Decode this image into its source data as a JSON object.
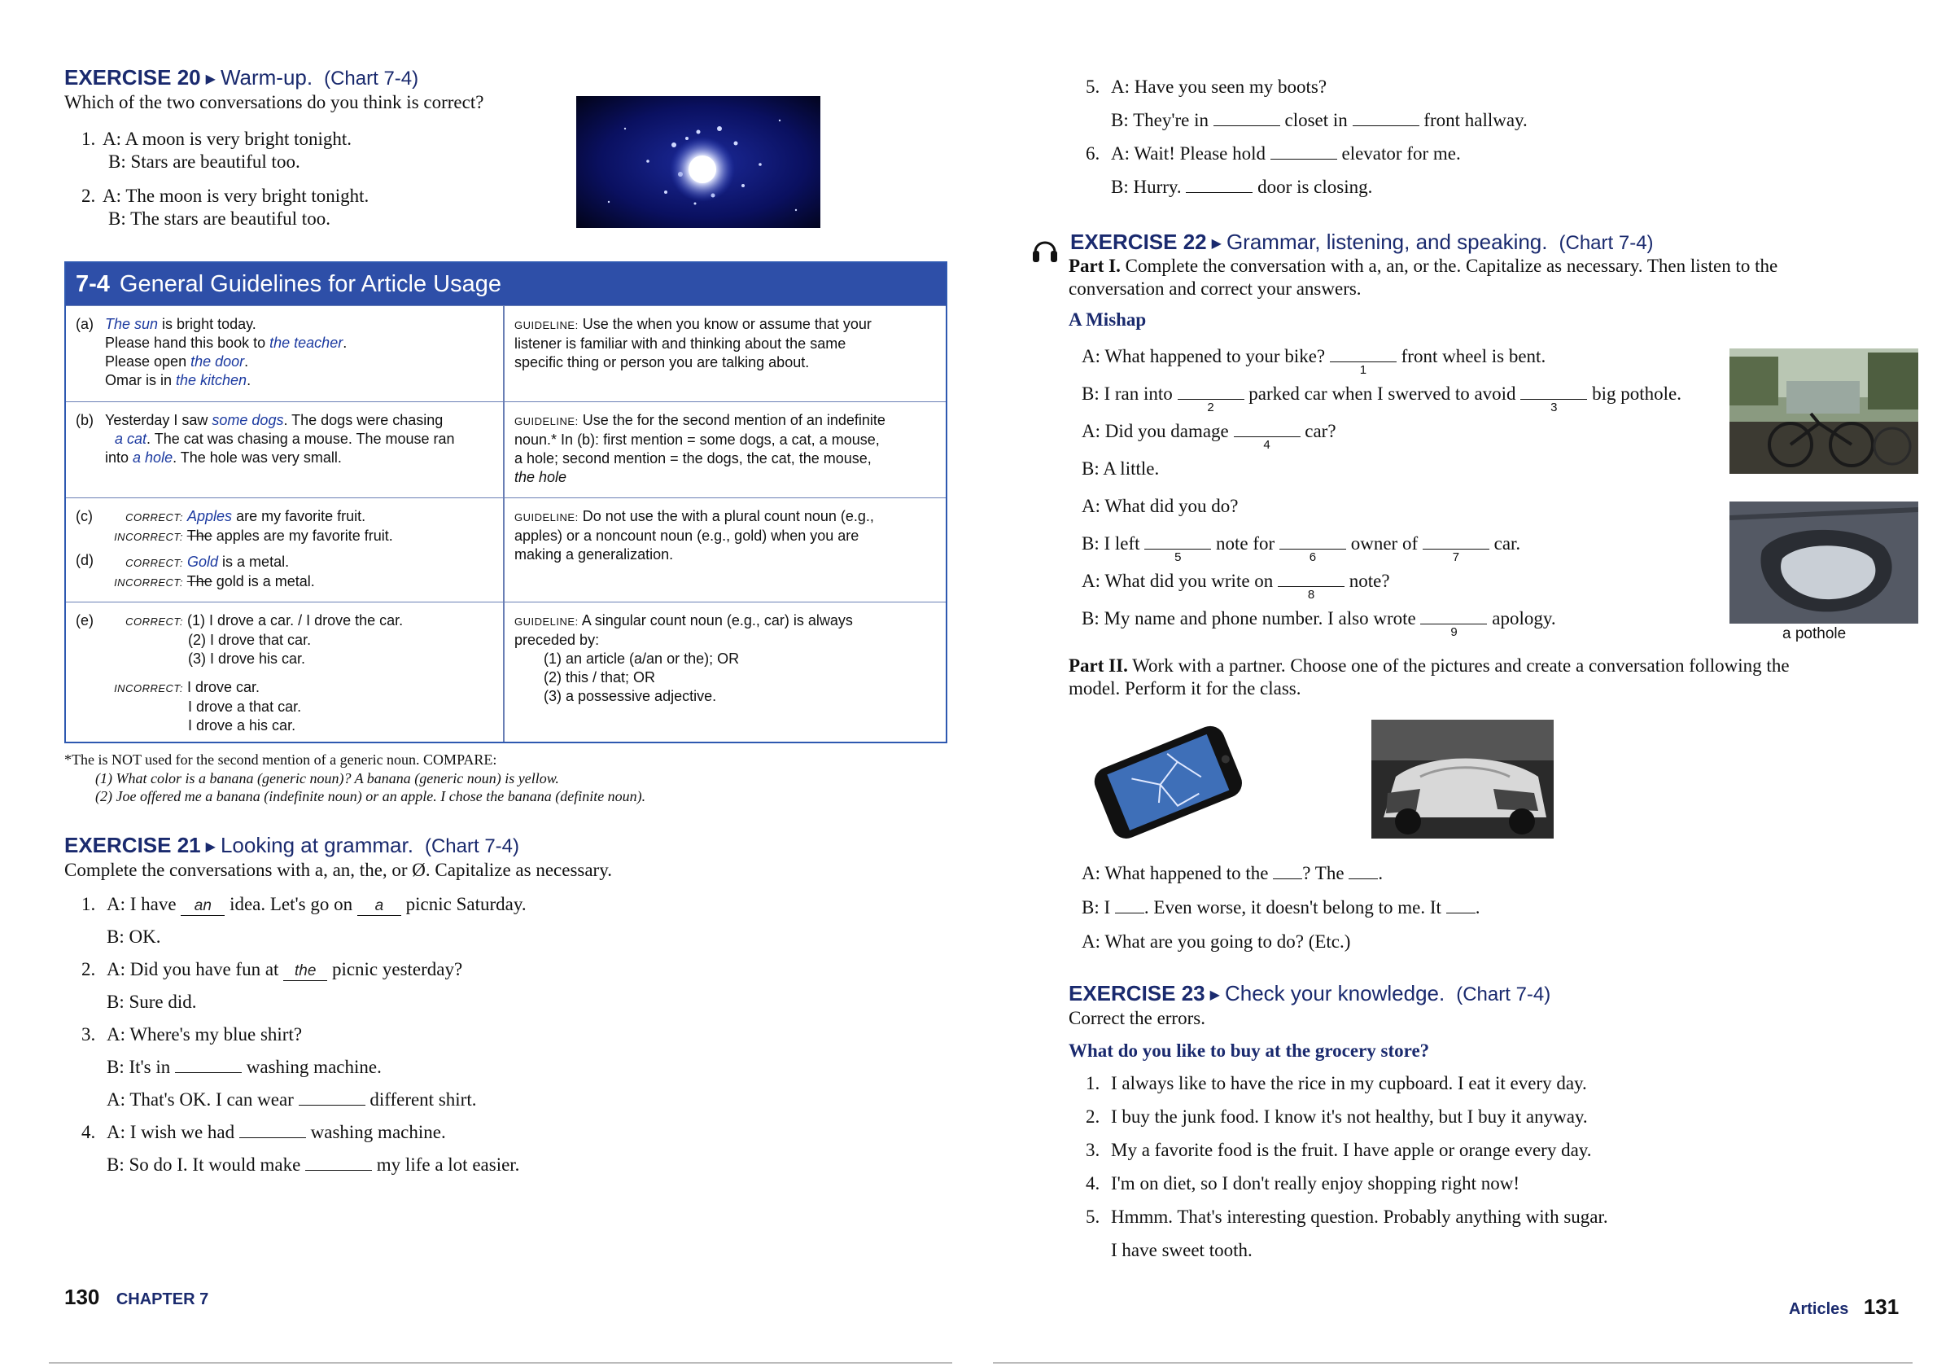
{
  "left_page": {
    "ex20": {
      "num": "EXERCISE 20",
      "title": "Warm-up.",
      "chart": "(Chart 7-4)",
      "instruction": "Which of the two conversations do you think is correct?",
      "items": [
        {
          "n": "1.",
          "a": "A: A moon is very bright tonight.",
          "b": "B: Stars are beautiful too."
        },
        {
          "n": "2.",
          "a": "A: The moon is very bright tonight.",
          "b": "B: The stars are beautiful too."
        }
      ]
    },
    "chart": {
      "num": "7-4",
      "title": "General Guidelines for Article Usage",
      "rows": [
        {
          "label": "(a)",
          "examples": [
            {
              "pre": "",
              "blue": "The sun",
              "post": " is bright today."
            },
            {
              "pre": "Please hand this book to ",
              "blue": "the teacher",
              "post": "."
            },
            {
              "pre": "Please open ",
              "blue": "the door",
              "post": "."
            },
            {
              "pre": "Omar is in ",
              "blue": "the kitchen",
              "post": "."
            }
          ],
          "guideline_tag": "GUIDELINE:",
          "guideline": [
            "Use the when you know or assume that your",
            "listener is familiar with and thinking about the same",
            "specific thing or person you are talking about."
          ]
        },
        {
          "label": "(b)",
          "examples": [
            {
              "pre": "Yesterday I saw ",
              "blue": "some dogs",
              "post": ". The dogs were chasing"
            },
            {
              "pre": "",
              "blue": "a cat",
              "post": ". The cat was chasing a mouse. The mouse ran"
            },
            {
              "pre": "into ",
              "blue": "a hole",
              "post": ". The hole was very small."
            }
          ],
          "guideline_tag": "GUIDELINE:",
          "guideline": [
            "Use the for the second mention of an indefinite",
            "noun.* In (b): first mention = some dogs, a cat, a mouse,",
            "a hole; second mention = the dogs, the cat, the mouse,",
            "the hole"
          ]
        },
        {
          "label_c": "(c)",
          "label_d": "(d)",
          "correct": "CORRECT:",
          "incorrect": "INCORRECT:",
          "c_correct_blue": "Apples",
          "c_correct_post": " are my favorite fruit.",
          "c_incorrect_strike": "The",
          "c_incorrect_post": " apples are my favorite fruit.",
          "d_correct_blue": "Gold",
          "d_correct_post": " is a metal.",
          "d_incorrect_strike": "The",
          "d_incorrect_post": " gold is a metal.",
          "guideline_tag": "GUIDELINE:",
          "guideline": [
            "Do not use the with a plural count noun (e.g.,",
            "apples) or a noncount noun (e.g., gold) when you are",
            "making a generalization."
          ]
        },
        {
          "label": "(e)",
          "correct": "CORRECT:",
          "incorrect": "INCORRECT:",
          "correct_lines": [
            "(1)  I drove a car. / I drove the car.",
            "(2)  I drove that car.",
            "(3)  I drove his car."
          ],
          "incorrect_lines": [
            "I drove car.",
            "I drove a that car.",
            "I drove a his car."
          ],
          "guideline_tag": "GUIDELINE:",
          "guideline": [
            "A singular count noun (e.g., car) is always",
            "preceded by:",
            "(1)  an article (a/an or the); OR",
            "(2)  this / that; OR",
            "(3)  a possessive adjective."
          ]
        }
      ]
    },
    "footnote": [
      "*The is NOT used for the second mention of a generic noun.  COMPARE:",
      "(1)  What color is a banana (generic noun)?  A banana (generic noun) is yellow.",
      "(2)  Joe offered me a banana (indefinite noun) or an apple.  I chose the banana (definite noun)."
    ],
    "ex21": {
      "num": "EXERCISE 21",
      "title": "Looking at grammar.",
      "chart": "(Chart 7-4)",
      "instruction": "Complete the conversations with a, an, the, or Ø.  Capitalize as necessary.",
      "lines": [
        {
          "n": "1.",
          "parts": [
            "A: I have ",
            "{an}",
            " idea.  Let's go on ",
            "{a}",
            " picnic Saturday."
          ]
        },
        {
          "n": "",
          "parts": [
            "B: OK."
          ]
        },
        {
          "n": "2.",
          "parts": [
            "A: Did you have fun at ",
            "{the}",
            " picnic yesterday?"
          ]
        },
        {
          "n": "",
          "parts": [
            "B: Sure did."
          ]
        },
        {
          "n": "3.",
          "parts": [
            "A: Where's my blue shirt?"
          ]
        },
        {
          "n": "",
          "parts": [
            "B: It's in ",
            "{}",
            " washing machine."
          ]
        },
        {
          "n": "",
          "parts": [
            "A: That's OK.  I can wear ",
            "{}",
            " different shirt."
          ]
        },
        {
          "n": "4.",
          "parts": [
            "A: I wish we had ",
            "{}",
            " washing machine."
          ]
        },
        {
          "n": "",
          "parts": [
            "B: So do I.  It would make ",
            "{}",
            " my life a lot easier."
          ]
        }
      ]
    },
    "folio": {
      "page": "130",
      "chapter": "CHAPTER 7"
    }
  },
  "right_page": {
    "ex21_cont": [
      {
        "n": "5.",
        "parts": [
          "A: Have you seen my boots?"
        ]
      },
      {
        "n": "",
        "parts": [
          "B: They're in ",
          "{}",
          " closet in ",
          "{}",
          " front hallway."
        ]
      },
      {
        "n": "6.",
        "parts": [
          "A: Wait!  Please hold ",
          "{}",
          " elevator for me."
        ]
      },
      {
        "n": "",
        "parts": [
          "B: Hurry. ",
          "{}",
          " door is closing."
        ]
      }
    ],
    "ex22": {
      "num": "EXERCISE 22",
      "title": "Grammar, listening, and speaking.",
      "chart": "(Chart 7-4)",
      "part1_label": "Part I.",
      "part1_text": "Complete the conversation with a, an, or the.  Capitalize as necessary.  Then listen to the",
      "part1_text2": "conversation and correct your answers.",
      "subtitle": "A Mishap",
      "dialog": [
        {
          "parts": [
            "A: What happened to your bike? ",
            "{1}",
            " front wheel is bent."
          ]
        },
        {
          "parts": [
            "B: I ran into ",
            "{2}",
            " parked car when I swerved to avoid ",
            "{3}",
            " big pothole."
          ]
        },
        {
          "parts": [
            "A: Did you damage ",
            "{4}",
            " car?"
          ]
        },
        {
          "parts": [
            "B: A little."
          ]
        },
        {
          "parts": [
            "A: What did you do?"
          ]
        },
        {
          "parts": [
            "B: I left ",
            "{5}",
            " note for ",
            "{6}",
            " owner of ",
            "{7}",
            " car."
          ]
        },
        {
          "parts": [
            "A: What did you write on ",
            "{8}",
            " note?"
          ]
        },
        {
          "parts": [
            "B: My name and phone number.  I also wrote ",
            "{9}",
            " apology."
          ]
        }
      ],
      "pothole_caption": "a pothole",
      "part2_label": "Part II.",
      "part2_text": "Work with a partner.  Choose one of the pictures and create a conversation following the",
      "part2_text2": "model.  Perform it for the class.",
      "model": [
        {
          "parts": [
            "A: What happened to the ",
            "{s}",
            "? The ",
            "{s}",
            "."
          ]
        },
        {
          "parts": [
            "B: I ",
            "{s}",
            ".  Even worse, it doesn't belong to me.  It ",
            "{s}",
            "."
          ]
        },
        {
          "parts": [
            "A: What are you going to do?  (Etc.)"
          ]
        }
      ]
    },
    "ex23": {
      "num": "EXERCISE 23",
      "title": "Check your knowledge.",
      "chart": "(Chart 7-4)",
      "instruction": "Correct the errors.",
      "subtitle": "What do you like to buy at the grocery store?",
      "items": [
        {
          "n": "1.",
          "text": "I always like to have the rice in my cupboard.  I eat it every day."
        },
        {
          "n": "2.",
          "text": "I buy the junk food.  I know it's not healthy, but I buy it anyway."
        },
        {
          "n": "3.",
          "text": "My a favorite food is the fruit.  I have apple or orange every day."
        },
        {
          "n": "4.",
          "text": "I'm on diet, so I don't really enjoy shopping right now!"
        },
        {
          "n": "5.",
          "text": "Hmmm.  That's interesting question.  Probably anything with sugar."
        },
        {
          "n": "",
          "text": "I have sweet tooth."
        }
      ]
    },
    "folio": {
      "section": "Articles",
      "page": "131"
    }
  },
  "colors": {
    "heading": "#1a2a6e",
    "chart_band": "#2e4fa8",
    "example_blue": "#1c3aa0"
  },
  "icons": [
    "triangle-marker-icon",
    "headphones-icon"
  ]
}
